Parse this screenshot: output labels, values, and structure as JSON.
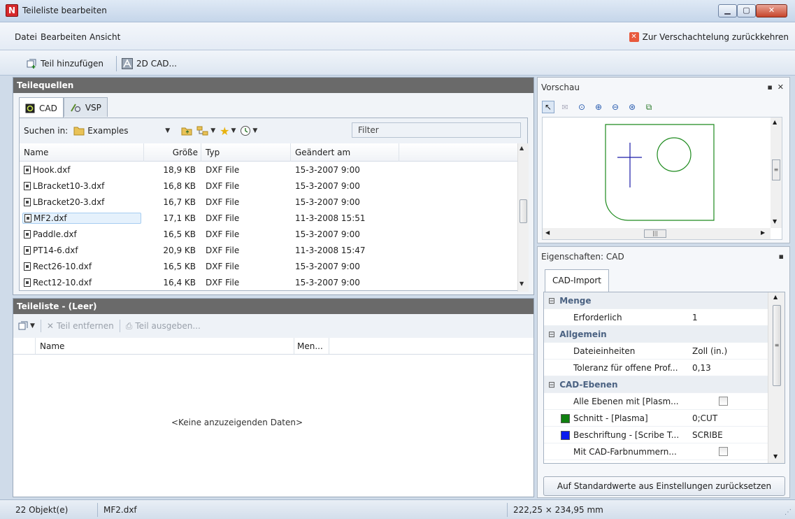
{
  "window": {
    "title": "Teileliste bearbeiten",
    "icon_letter": "N"
  },
  "menu": {
    "items": [
      "Datei",
      "Bearbeiten",
      "Ansicht"
    ],
    "return_label": "Zur Verschachtelung zurückkehren"
  },
  "toolbar": {
    "add_part": "Teil hinzufügen",
    "cad2d": "2D CAD..."
  },
  "sources": {
    "title": "Teilequellen",
    "tabs": [
      "CAD",
      "VSP"
    ],
    "search_label": "Suchen in:",
    "folder": "Examples",
    "filter_placeholder": "Filter",
    "columns": [
      "Name",
      "Größe",
      "Typ",
      "Geändert am"
    ],
    "files": [
      {
        "name": "Hook.dxf",
        "size": "18,9 KB",
        "type": "DXF File",
        "modified": "15-3-2007 9:00"
      },
      {
        "name": "LBracket10-3.dxf",
        "size": "16,8 KB",
        "type": "DXF File",
        "modified": "15-3-2007 9:00"
      },
      {
        "name": "LBracket20-3.dxf",
        "size": "16,7 KB",
        "type": "DXF File",
        "modified": "15-3-2007 9:00"
      },
      {
        "name": "MF2.dxf",
        "size": "17,1 KB",
        "type": "DXF File",
        "modified": "11-3-2008 15:51"
      },
      {
        "name": "Paddle.dxf",
        "size": "16,5 KB",
        "type": "DXF File",
        "modified": "15-3-2007 9:00"
      },
      {
        "name": "PT14-6.dxf",
        "size": "20,9 KB",
        "type": "DXF File",
        "modified": "11-3-2008 15:47"
      },
      {
        "name": "Rect26-10.dxf",
        "size": "16,5 KB",
        "type": "DXF File",
        "modified": "15-3-2007 9:00"
      },
      {
        "name": "Rect12-10.dxf",
        "size": "16,4 KB",
        "type": "DXF File",
        "modified": "15-3-2007 9:00"
      }
    ],
    "selected_file": "MF2.dxf"
  },
  "partlist": {
    "title": "Teileliste  -  (Leer)",
    "remove_label": "Teil entfernen",
    "output_label": "Teil ausgeben...",
    "columns": [
      "Name",
      "Men..."
    ],
    "empty_message": "<Keine anzuzeigenden Daten>"
  },
  "preview": {
    "title": "Vorschau"
  },
  "properties": {
    "title": "Eigenschaften: CAD",
    "tab": "CAD-Import",
    "categories": {
      "menge": "Menge",
      "allgemein": "Allgemein",
      "ebenen": "CAD-Ebenen"
    },
    "rows": {
      "erforderlich": {
        "name": "Erforderlich",
        "value": "1"
      },
      "einheiten": {
        "name": "Dateieinheiten",
        "value": "Zoll (in.)"
      },
      "toleranz": {
        "name": "Toleranz für offene Prof...",
        "value": "0,13"
      },
      "alle": {
        "name": "Alle Ebenen mit [Plasm...",
        "checked": false
      },
      "schnitt": {
        "name": "Schnitt - [Plasma]",
        "value": "0;CUT",
        "color": "#108010"
      },
      "beschriftung": {
        "name": "Beschriftung - [Scribe T...",
        "value": "SCRIBE",
        "color": "#0a1aee"
      },
      "farbnummern": {
        "name": "Mit CAD-Farbnummern...",
        "checked": false
      }
    },
    "reset_label": "Auf Standardwerte aus Einstellungen zurücksetzen"
  },
  "status": {
    "count": "22 Objekt(e)",
    "file": "MF2.dxf",
    "dimensions": "222,25 × 234,95 mm"
  },
  "colors": {
    "header_dark": "#6a6a6a",
    "preview_outline": "#1d8a1d",
    "preview_line": "#1a1aa8"
  }
}
